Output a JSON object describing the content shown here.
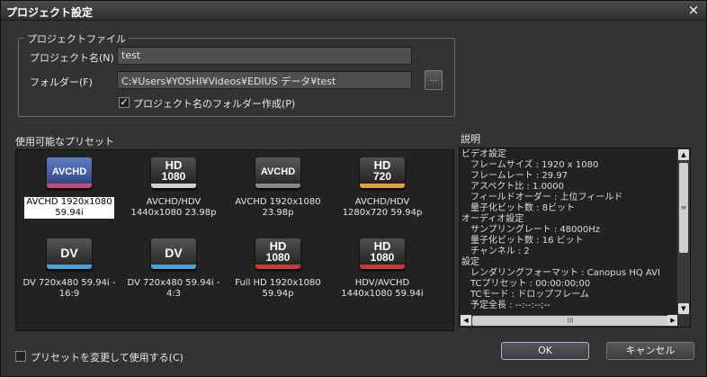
{
  "window": {
    "title": "プロジェクト設定",
    "close": "×"
  },
  "project_file": {
    "legend": "プロジェクトファイル",
    "name_label": "プロジェクト名(N)",
    "name_value": "test",
    "folder_label": "フォルダー(F)",
    "folder_value": "C:¥Users¥YOSHI¥Videos¥EDIUS データ¥test",
    "browse_label": "...",
    "create_folder_label": "プロジェクト名のフォルダー作成(P)",
    "create_folder_checked": true
  },
  "presets": {
    "label": "使用可能なプリセット",
    "items": [
      {
        "icon_text": "AVCHD",
        "icon_sub": "",
        "icon": "avchd-icon",
        "line1": "AVCHD 1920x1080",
        "line2": "59.94i",
        "selected": true,
        "bar": "#c64a76"
      },
      {
        "icon_text": "HD",
        "icon_sub": "1080",
        "icon": "hd1080-icon",
        "line1": "AVCHD/HDV",
        "line2": "1440x1080 23.98p",
        "selected": false,
        "bar": "#d0d0d0"
      },
      {
        "icon_text": "AVCHD",
        "icon_sub": "",
        "icon": "avchd-icon",
        "line1": "AVCHD 1920x1080",
        "line2": "23.98p",
        "selected": false,
        "bar": "#888888"
      },
      {
        "icon_text": "HD",
        "icon_sub": "720",
        "icon": "hd720-icon",
        "line1": "AVCHD/HDV",
        "line2": "1280x720 59.94p",
        "selected": false,
        "bar": "#e2a23a"
      },
      {
        "icon_text": "DV",
        "icon_sub": "",
        "icon": "dv-icon",
        "line1": "DV 720x480 59.94i -",
        "line2": "16:9",
        "selected": false,
        "bar": "#4aa0d8"
      },
      {
        "icon_text": "DV",
        "icon_sub": "",
        "icon": "dv-icon",
        "line1": "DV 720x480 59.94i -",
        "line2": "4:3",
        "selected": false,
        "bar": "#4aa0d8"
      },
      {
        "icon_text": "HD",
        "icon_sub": "1080",
        "icon": "hd1080-icon",
        "line1": "Full HD 1920x1080",
        "line2": "59.94p",
        "selected": false,
        "bar": "#c63a3a"
      },
      {
        "icon_text": "HD",
        "icon_sub": "1080",
        "icon": "hd1080-icon",
        "line1": "HDV/AVCHD",
        "line2": "1440x1080 59.94i",
        "selected": false,
        "bar": "#c63a3a"
      }
    ]
  },
  "description": {
    "label": "説明",
    "lines": [
      {
        "text": "ビデオ設定",
        "header": true
      },
      {
        "text": "フレームサイズ : 1920 x 1080",
        "header": false
      },
      {
        "text": "フレームレート : 29.97",
        "header": false
      },
      {
        "text": "アスペクト比 : 1.0000",
        "header": false
      },
      {
        "text": "フィールドオーダー : 上位フィールド",
        "header": false
      },
      {
        "text": "量子化ビット数 : 8ビット",
        "header": false
      },
      {
        "text": "オーディオ設定",
        "header": true
      },
      {
        "text": "サンプリングレート : 48000Hz",
        "header": false
      },
      {
        "text": "量子化ビット数 : 16 ビット",
        "header": false
      },
      {
        "text": "チャンネル : 2",
        "header": false
      },
      {
        "text": "設定",
        "header": true
      },
      {
        "text": "レンダリングフォーマット : Canopus HQ AVI",
        "header": false
      },
      {
        "text": "TCプリセット : 00:00:00;00",
        "header": false
      },
      {
        "text": "TCモード : ドロップフレーム",
        "header": false
      },
      {
        "text": "予定全長 : --:--:--;--",
        "header": false
      }
    ]
  },
  "modify_preset": {
    "label": "プリセットを変更して使用する(C)",
    "checked": false
  },
  "buttons": {
    "ok": "OK",
    "cancel": "キャンセル"
  }
}
